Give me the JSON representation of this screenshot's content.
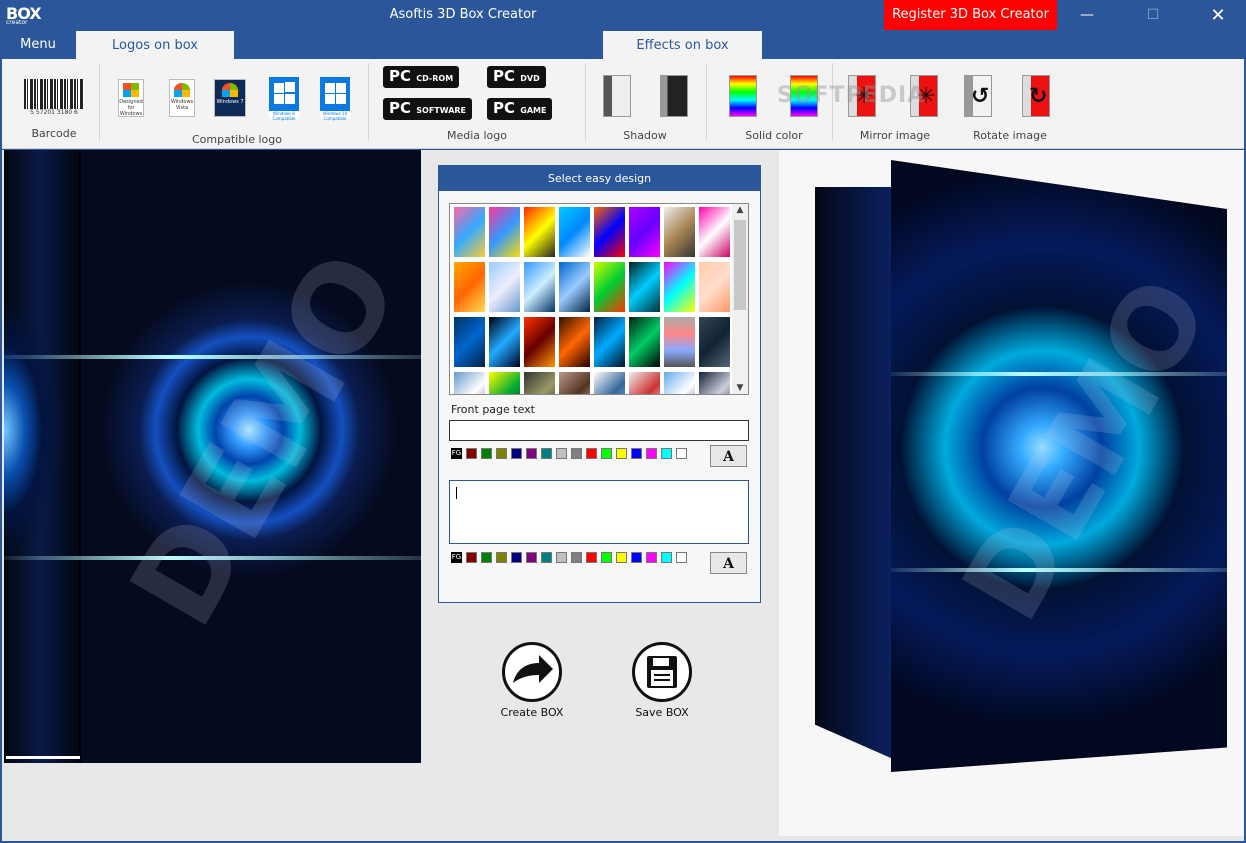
{
  "window": {
    "title": "Asoftis 3D Box Creator",
    "register_label": "Register 3D Box Creator",
    "minimize": "—",
    "maximize": "☐",
    "close": "✕",
    "logo_text": "BOX",
    "logo_sub": "creator"
  },
  "tabs": {
    "menu": "Menu",
    "logos_on_box": "Logos on box",
    "effects_on_box": "Effects on box"
  },
  "ribbon": {
    "barcode_label": "Barcode",
    "barcode_digits": "5 57201 3180 6",
    "compatible_logo_label": "Compatible logo",
    "media_logo_label": "Media logo",
    "shadow_label": "Shadow",
    "solid_color_label": "Solid color",
    "mirror_image_label": "Mirror image",
    "rotate_image_label": "Rotate image",
    "logo_xp": "Designed for Windows XP",
    "logo_vista": "Windows Vista",
    "logo_win7": "Windows 7",
    "logo_win8": "Windows 8 Compatible",
    "logo_win10": "Windows 10 Compatible",
    "media": {
      "cdrom": {
        "big": "PC",
        "small": "CD-ROM"
      },
      "dvd": {
        "big": "PC",
        "small": "DVD"
      },
      "software": {
        "big": "PC",
        "small": "SOFTWARE"
      },
      "game": {
        "big": "PC",
        "small": "GAME"
      }
    },
    "watermark": "SOFTPEDIA"
  },
  "panel": {
    "header": "Select easy design",
    "front_page_text_label": "Front page text",
    "front_page_text_value": "",
    "body_text_value": "",
    "fg_label": "FG",
    "font_button": "A",
    "scroll_up": "▲",
    "scroll_down": "▼"
  },
  "swatch_colors": [
    "#800000",
    "#008000",
    "#808000",
    "#000080",
    "#800080",
    "#008080",
    "#c0c0c0",
    "#808080",
    "#ff0000",
    "#00ff00",
    "#ffff00",
    "#0000ff",
    "#ff00ff",
    "#00ffff",
    "#ffffff"
  ],
  "actions": {
    "create_box": "Create BOX",
    "save_box": "Save BOX"
  },
  "demo_watermark": "DEMO"
}
